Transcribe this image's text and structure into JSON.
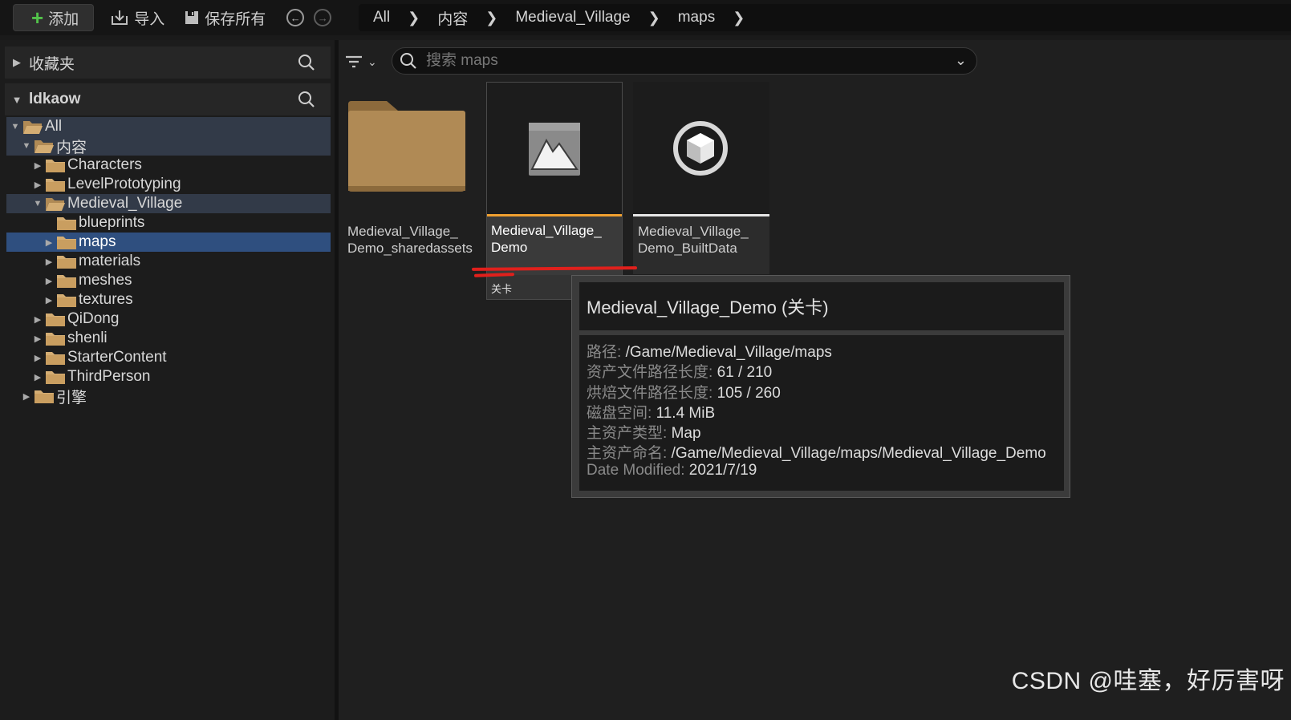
{
  "toolbar": {
    "add_label": "添加",
    "import_label": "导入",
    "save_all_label": "保存所有"
  },
  "breadcrumb": [
    "All",
    "内容",
    "Medieval_Village",
    "maps"
  ],
  "sidebar": {
    "favorites_label": "收藏夹",
    "project_label": "ldkaow",
    "tree": [
      {
        "label": "All",
        "depth": 0,
        "expanded": true,
        "state": "hl"
      },
      {
        "label": "内容",
        "depth": 1,
        "expanded": true,
        "state": "hl"
      },
      {
        "label": "Characters",
        "depth": 2,
        "expanded": false,
        "state": ""
      },
      {
        "label": "LevelPrototyping",
        "depth": 2,
        "expanded": false,
        "state": ""
      },
      {
        "label": "Medieval_Village",
        "depth": 2,
        "expanded": true,
        "state": "hl"
      },
      {
        "label": "blueprints",
        "depth": 3,
        "expanded": null,
        "state": ""
      },
      {
        "label": "maps",
        "depth": 3,
        "expanded": false,
        "state": "sel"
      },
      {
        "label": "materials",
        "depth": 3,
        "expanded": false,
        "state": ""
      },
      {
        "label": "meshes",
        "depth": 3,
        "expanded": false,
        "state": ""
      },
      {
        "label": "textures",
        "depth": 3,
        "expanded": false,
        "state": ""
      },
      {
        "label": "QiDong",
        "depth": 2,
        "expanded": false,
        "state": ""
      },
      {
        "label": "shenli",
        "depth": 2,
        "expanded": false,
        "state": ""
      },
      {
        "label": "StarterContent",
        "depth": 2,
        "expanded": false,
        "state": ""
      },
      {
        "label": "ThirdPerson",
        "depth": 2,
        "expanded": false,
        "state": ""
      },
      {
        "label": "引擎",
        "depth": 1,
        "expanded": false,
        "state": ""
      }
    ]
  },
  "search": {
    "placeholder": "搜索 maps"
  },
  "assets": {
    "folder_label": "Medieval_Village_\nDemo_sharedassets",
    "map_label": "Medieval_Village_\nDemo",
    "map_type": "关卡",
    "builtdata_label": "Medieval_Village_\nDemo_BuiltData"
  },
  "tooltip": {
    "title": "Medieval_Village_Demo (关卡)",
    "rows": [
      {
        "key": "路径:",
        "value": "/Game/Medieval_Village/maps"
      },
      {
        "key": "资产文件路径长度:",
        "value": "61 / 210"
      },
      {
        "key": "烘焙文件路径长度:",
        "value": "105 / 260"
      },
      {
        "key": "磁盘空间:",
        "value": "11.4 MiB"
      },
      {
        "key": "主资产类型:",
        "value": "Map"
      },
      {
        "key": "主资产命名:",
        "value": "/Game/Medieval_Village/maps/Medieval_Village_Demo"
      },
      {
        "key": "Date Modified:",
        "value": "2021/7/19"
      }
    ]
  },
  "watermark": "CSDN @哇塞，好厉害呀",
  "colors": {
    "accent_orange": "#f0a030",
    "selection_blue": "#2f4f7f",
    "folder_tan": "#b08a55",
    "annotation_red": "#e0201c"
  }
}
